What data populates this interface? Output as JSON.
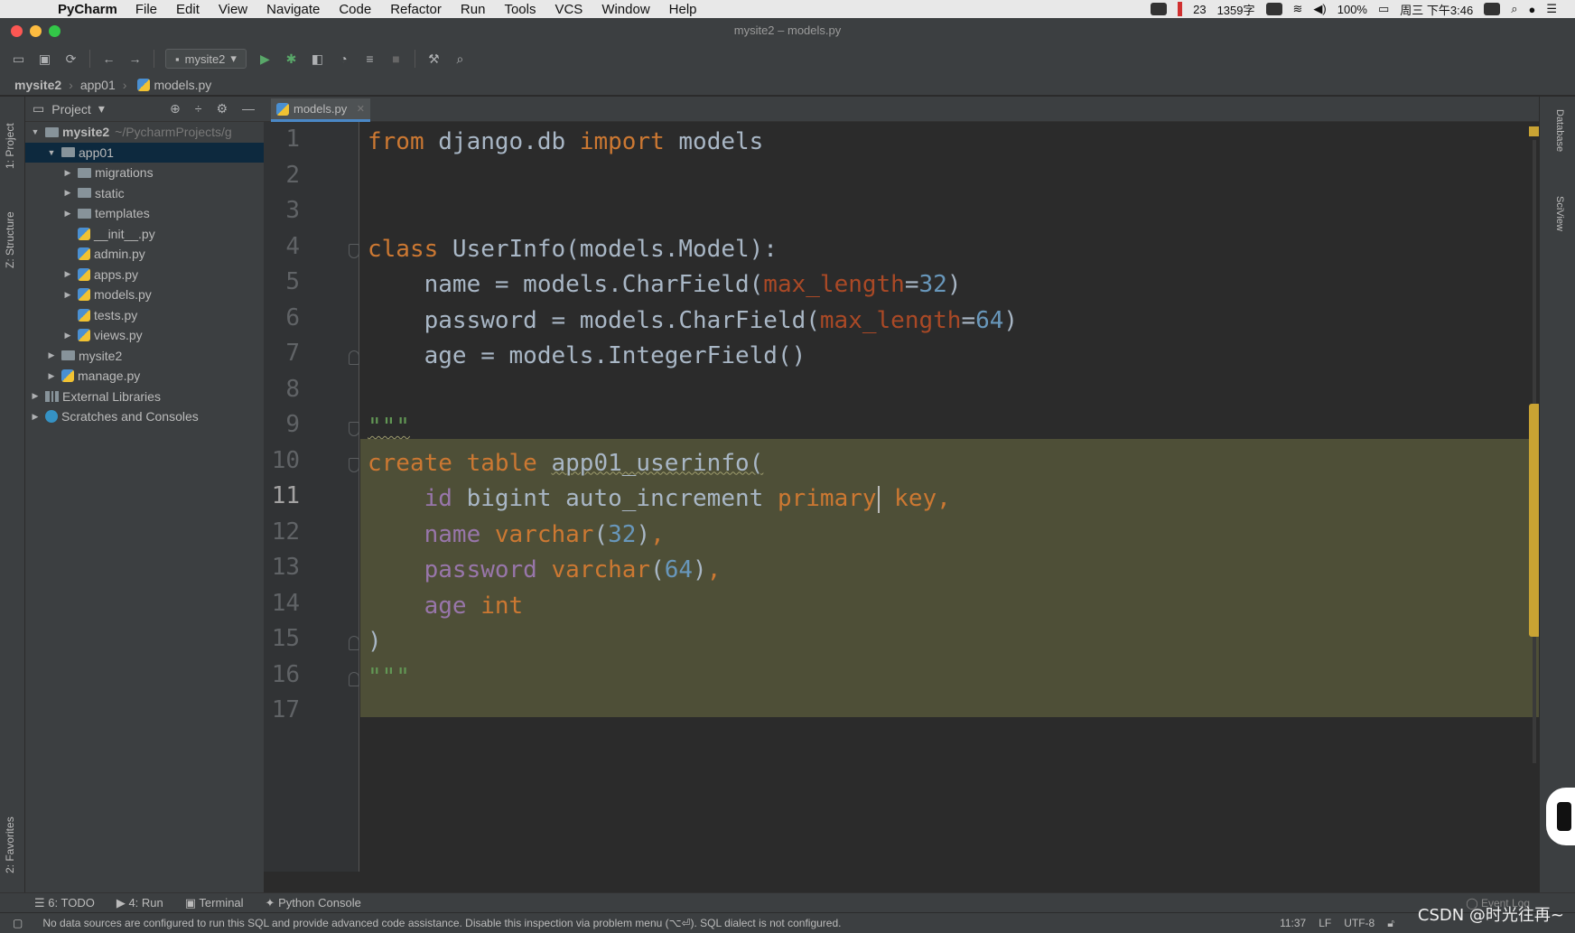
{
  "menubar": {
    "app_name": "PyCharm",
    "items": [
      "File",
      "Edit",
      "View",
      "Navigate",
      "Code",
      "Refactor",
      "Run",
      "Tools",
      "VCS",
      "Window",
      "Help"
    ],
    "tray": {
      "badge": "23",
      "words": "1359字",
      "battery": "100%",
      "clock": "周三 下午3:46"
    }
  },
  "window": {
    "title": "mysite2 – models.py"
  },
  "toolbar": {
    "run_config": "mysite2"
  },
  "breadcrumb": [
    "mysite2",
    "app01",
    "models.py"
  ],
  "project_panel": {
    "header": "Project",
    "tree": [
      {
        "label": "mysite2",
        "hint": "~/PycharmProjects/g",
        "level": 0,
        "kind": "folder",
        "expanded": true
      },
      {
        "label": "app01",
        "level": 1,
        "kind": "folder",
        "expanded": true,
        "selected": true
      },
      {
        "label": "migrations",
        "level": 2,
        "kind": "folder",
        "expanded": false
      },
      {
        "label": "static",
        "level": 2,
        "kind": "folder",
        "expanded": false
      },
      {
        "label": "templates",
        "level": 2,
        "kind": "folder",
        "expanded": false
      },
      {
        "label": "__init__.py",
        "level": 2,
        "kind": "py"
      },
      {
        "label": "admin.py",
        "level": 2,
        "kind": "py"
      },
      {
        "label": "apps.py",
        "level": 2,
        "kind": "py",
        "expandable": true
      },
      {
        "label": "models.py",
        "level": 2,
        "kind": "py",
        "expandable": true
      },
      {
        "label": "tests.py",
        "level": 2,
        "kind": "py"
      },
      {
        "label": "views.py",
        "level": 2,
        "kind": "py",
        "expandable": true
      },
      {
        "label": "mysite2",
        "level": 1,
        "kind": "folder",
        "expanded": false
      },
      {
        "label": "manage.py",
        "level": 1,
        "kind": "py",
        "expandable": true
      },
      {
        "label": "External Libraries",
        "level": 0,
        "kind": "lib",
        "expanded": false
      },
      {
        "label": "Scratches and Consoles",
        "level": 0,
        "kind": "scratch",
        "expanded": false
      }
    ]
  },
  "stripes": {
    "left": [
      "1: Project",
      "Z: Structure",
      "2: Favorites"
    ],
    "right": [
      "Database",
      "SciView"
    ]
  },
  "editor": {
    "tab": "models.py",
    "current_line": 11,
    "lines": [
      [
        [
          "kw",
          "from "
        ],
        [
          "",
          "django.db "
        ],
        [
          "kw",
          "import "
        ],
        [
          "",
          "models"
        ]
      ],
      [],
      [],
      [
        [
          "kw",
          "class "
        ],
        [
          "",
          "UserInfo(models.Model):"
        ]
      ],
      [
        [
          "",
          "    name = models.CharField("
        ],
        [
          "param",
          "max_length"
        ],
        [
          "",
          "="
        ],
        [
          "num",
          "32"
        ],
        [
          "",
          ")"
        ]
      ],
      [
        [
          "",
          "    password = models.CharField("
        ],
        [
          "param",
          "max_length"
        ],
        [
          "",
          "="
        ],
        [
          "num",
          "64"
        ],
        [
          "",
          ")"
        ]
      ],
      [
        [
          "",
          "    age = models.IntegerField()"
        ]
      ],
      [],
      [
        [
          "str",
          "\"\"\""
        ]
      ],
      [
        [
          "kw",
          "create table "
        ],
        [
          "",
          "app01_userinfo("
        ]
      ],
      [
        [
          "sql-col",
          "    id "
        ],
        [
          "",
          "bigint auto_increment "
        ],
        [
          "kw",
          "primary"
        ],
        [
          "caret",
          ""
        ],
        [
          "kw",
          " key,"
        ]
      ],
      [
        [
          "sql-col",
          "    name "
        ],
        [
          "kw",
          "varchar"
        ],
        [
          "",
          "("
        ],
        [
          "num",
          "32"
        ],
        [
          "",
          ")"
        ],
        [
          "kw",
          ","
        ]
      ],
      [
        [
          "sql-col",
          "    password "
        ],
        [
          "kw",
          "varchar"
        ],
        [
          "",
          "("
        ],
        [
          "num",
          "64"
        ],
        [
          "",
          ")"
        ],
        [
          "kw",
          ","
        ]
      ],
      [
        [
          "sql-col",
          "    age "
        ],
        [
          "kw",
          "int"
        ]
      ],
      [
        [
          "",
          ")"
        ]
      ],
      [
        [
          "str",
          "\"\"\""
        ]
      ],
      []
    ]
  },
  "bottom_tools": [
    "6: TODO",
    "4: Run",
    "Terminal",
    "Python Console",
    "Event Log"
  ],
  "status": {
    "message": "No data sources are configured to run this SQL and provide advanced code assistance. Disable this inspection via problem menu (⌥⏎). SQL dialect is not configured.",
    "position": "11:37",
    "line_sep": "LF",
    "encoding": "UTF-8"
  },
  "watermark": "CSDN @时光往再~"
}
